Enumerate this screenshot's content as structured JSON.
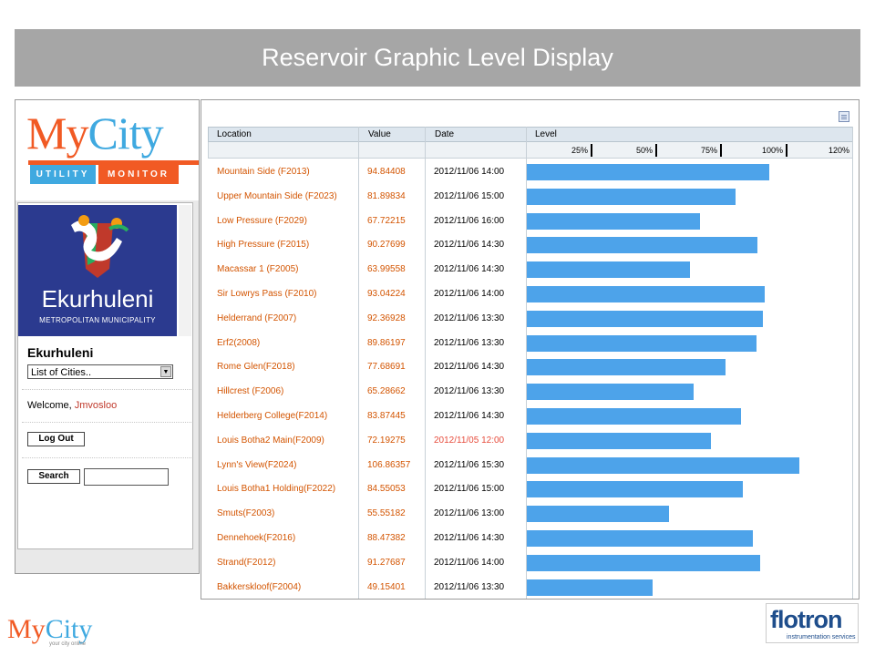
{
  "title": "Reservoir Graphic Level Display",
  "branding": {
    "logo_my": "My",
    "logo_city": "City",
    "utility": "UTILITY",
    "monitor": "MONITOR",
    "municipality_name": "Ekurhuleni",
    "municipality_sub": "METROPOLITAN MUNICIPALITY",
    "footer_my": "My",
    "footer_city": "City",
    "footer_tag": "your city online",
    "flotron": "flotron",
    "flotron_sub": "instrumentation services"
  },
  "sidebar": {
    "city_heading": "Ekurhuleni",
    "city_select_value": "List of Cities..",
    "welcome_label": "Welcome,",
    "username": "Jmvosloo",
    "logout_label": "Log Out",
    "search_label": "Search",
    "search_value": ""
  },
  "table": {
    "headers": {
      "location": "Location",
      "value": "Value",
      "date": "Date",
      "level": "Level"
    },
    "scale": [
      "25%",
      "50%",
      "75%",
      "100%",
      "120%"
    ],
    "rows": [
      {
        "location": "Mountain Side (F2013)",
        "value": "94.84408",
        "date": "2012/11/06 14:00",
        "level": 94.84408,
        "stale": false
      },
      {
        "location": "Upper Mountain Side (F2023)",
        "value": "81.89834",
        "date": "2012/11/06 15:00",
        "level": 81.89834,
        "stale": false
      },
      {
        "location": "Low Pressure (F2029)",
        "value": "67.72215",
        "date": "2012/11/06 16:00",
        "level": 67.72215,
        "stale": false
      },
      {
        "location": "High Pressure (F2015)",
        "value": "90.27699",
        "date": "2012/11/06 14:30",
        "level": 90.27699,
        "stale": false
      },
      {
        "location": "Macassar 1 (F2005)",
        "value": "63.99558",
        "date": "2012/11/06 14:30",
        "level": 63.99558,
        "stale": false
      },
      {
        "location": "Sir Lowrys Pass (F2010)",
        "value": "93.04224",
        "date": "2012/11/06 14:00",
        "level": 93.04224,
        "stale": false
      },
      {
        "location": "Helderrand (F2007)",
        "value": "92.36928",
        "date": "2012/11/06 13:30",
        "level": 92.36928,
        "stale": false
      },
      {
        "location": "Erf2(2008)",
        "value": "89.86197",
        "date": "2012/11/06 13:30",
        "level": 89.86197,
        "stale": false
      },
      {
        "location": "Rome Glen(F2018)",
        "value": "77.68691",
        "date": "2012/11/06 14:30",
        "level": 77.68691,
        "stale": false
      },
      {
        "location": "Hillcrest (F2006)",
        "value": "65.28662",
        "date": "2012/11/06 13:30",
        "level": 65.28662,
        "stale": false
      },
      {
        "location": "Helderberg College(F2014)",
        "value": "83.87445",
        "date": "2012/11/06 14:30",
        "level": 83.87445,
        "stale": false
      },
      {
        "location": "Louis Botha2 Main(F2009)",
        "value": "72.19275",
        "date": "2012/11/05 12:00",
        "level": 72.19275,
        "stale": true
      },
      {
        "location": "Lynn's View(F2024)",
        "value": "106.86357",
        "date": "2012/11/06 15:30",
        "level": 106.86357,
        "stale": false
      },
      {
        "location": "Louis Botha1 Holding(F2022)",
        "value": "84.55053",
        "date": "2012/11/06 15:00",
        "level": 84.55053,
        "stale": false
      },
      {
        "location": "Smuts(F2003)",
        "value": "55.55182",
        "date": "2012/11/06 13:00",
        "level": 55.55182,
        "stale": false
      },
      {
        "location": "Dennehoek(F2016)",
        "value": "88.47382",
        "date": "2012/11/06 14:30",
        "level": 88.47382,
        "stale": false
      },
      {
        "location": "Strand(F2012)",
        "value": "91.27687",
        "date": "2012/11/06 14:00",
        "level": 91.27687,
        "stale": false
      },
      {
        "location": "Bakkerskloof(F2004)",
        "value": "49.15401",
        "date": "2012/11/06 13:30",
        "level": 49.15401,
        "stale": false
      }
    ]
  },
  "colors": {
    "bar": "#4da3ea",
    "location_text": "#d35400",
    "stale_date": "#e74c3c",
    "brand_orange": "#f15a24",
    "brand_blue": "#3fa9e0",
    "title_bar": "#a6a6a6"
  },
  "icons": {
    "table_corner": "list-icon",
    "select_arrow": "chevron-down-icon"
  }
}
